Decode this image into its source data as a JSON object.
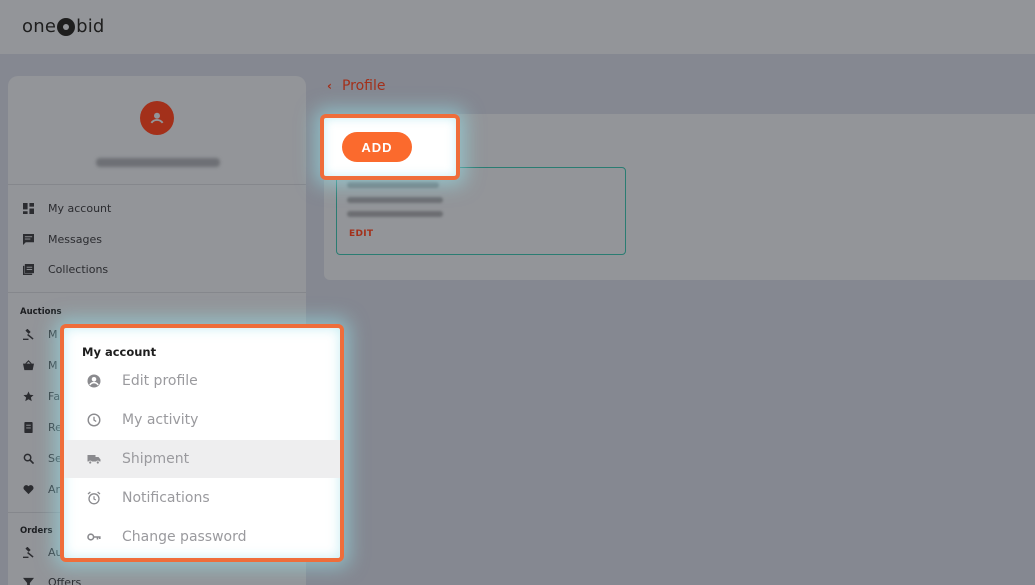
{
  "brand": {
    "left": "one",
    "right": "bid"
  },
  "page": {
    "back_label": "Profile"
  },
  "actions": {
    "add_label": "ADD"
  },
  "address_card": {
    "edit_label": "EDIT"
  },
  "sidebar": {
    "items": [
      {
        "label": "My account",
        "icon": "dashboard-icon"
      },
      {
        "label": "Messages",
        "icon": "message-icon"
      },
      {
        "label": "Collections",
        "icon": "collections-icon"
      }
    ],
    "auctions_label": "Auctions",
    "auction_items": [
      {
        "label": "M",
        "icon": "gavel-icon"
      },
      {
        "label": "M",
        "icon": "basket-icon"
      },
      {
        "label": "Fa",
        "icon": "star-icon"
      },
      {
        "label": "Re",
        "icon": "receipt-icon"
      },
      {
        "label": "Se",
        "icon": "search-icon"
      },
      {
        "label": "Ar",
        "icon": "heart-icon"
      }
    ],
    "orders_label": "Orders",
    "order_items": [
      {
        "label": "Au",
        "icon": "gavel-icon"
      },
      {
        "label": "Offers",
        "icon": "filter-icon"
      }
    ]
  },
  "popup": {
    "title": "My account",
    "items": [
      {
        "label": "Edit profile",
        "icon": "account-circle-icon"
      },
      {
        "label": "My activity",
        "icon": "clock-icon"
      },
      {
        "label": "Shipment",
        "icon": "truck-icon",
        "active": true
      },
      {
        "label": "Notifications",
        "icon": "alarm-icon"
      },
      {
        "label": "Change password",
        "icon": "key-icon"
      }
    ]
  },
  "colors": {
    "accent": "#fb6a2d",
    "highlight_border": "#ef6d3a",
    "link": "#a3301a",
    "address_border": "#2a7c72"
  }
}
